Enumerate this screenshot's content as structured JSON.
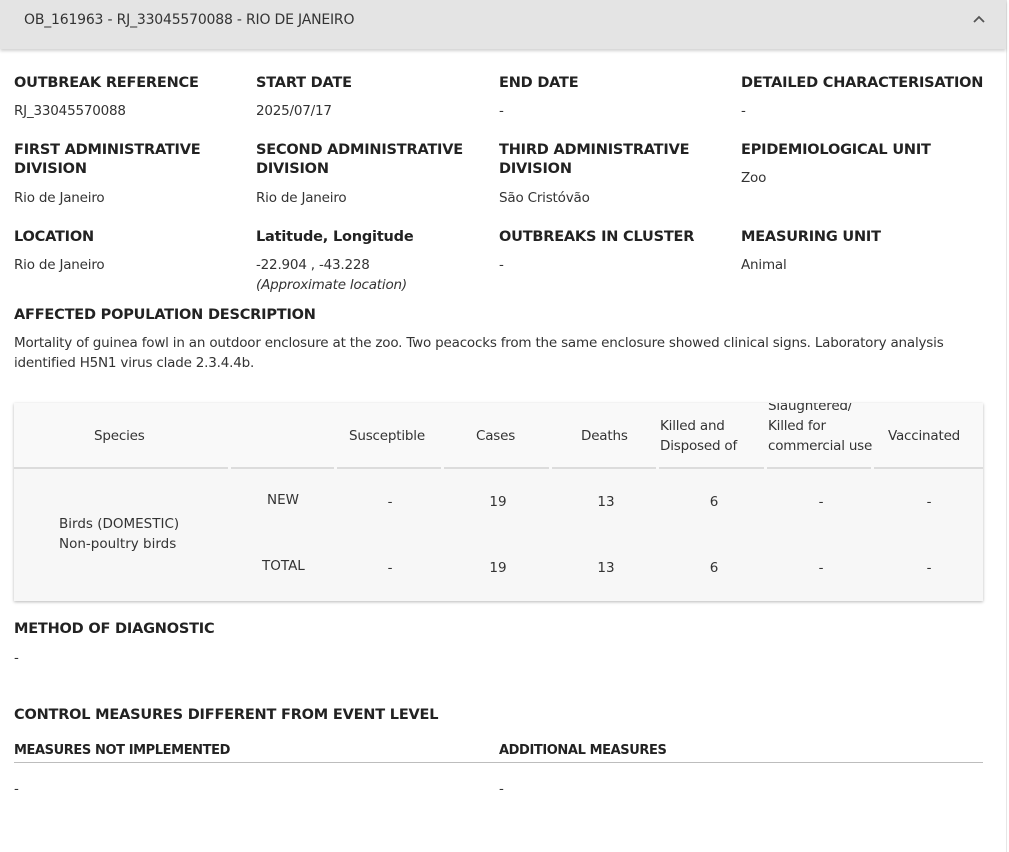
{
  "header": {
    "title": "OB_161963 - RJ_33045570088 - RIO DE JANEIRO"
  },
  "fields": {
    "outbreak_reference": {
      "label": "OUTBREAK REFERENCE",
      "value": "RJ_33045570088"
    },
    "start_date": {
      "label": "START DATE",
      "value": "2025/07/17"
    },
    "end_date": {
      "label": "END DATE",
      "value": "-"
    },
    "detailed_characterisation": {
      "label": "DETAILED CHARACTERISATION",
      "value": "-"
    },
    "first_admin": {
      "label": "FIRST ADMINISTRATIVE DIVISION",
      "value": "Rio de Janeiro"
    },
    "second_admin": {
      "label": "SECOND ADMINISTRATIVE DIVISION",
      "value": "Rio de Janeiro"
    },
    "third_admin": {
      "label": "THIRD ADMINISTRATIVE DIVISION",
      "value": "São Cristóvão"
    },
    "epi_unit": {
      "label": "EPIDEMIOLOGICAL UNIT",
      "value": "Zoo"
    },
    "location": {
      "label": "LOCATION",
      "value": "Rio de Janeiro"
    },
    "latlon": {
      "label": "Latitude, Longitude",
      "value": "-22.904 , -43.228",
      "note": "(Approximate location)"
    },
    "outbreaks_in_cluster": {
      "label": "OUTBREAKS IN CLUSTER",
      "value": "-"
    },
    "measuring_unit": {
      "label": "MEASURING UNIT",
      "value": "Animal"
    }
  },
  "affected_population": {
    "label": "AFFECTED POPULATION DESCRIPTION",
    "text": "Mortality of guinea fowl in an outdoor enclosure at the zoo. Two peacocks from the same enclosure showed clinical signs. Laboratory analysis identified H5N1 virus clade 2.3.4.4b."
  },
  "table": {
    "headers": {
      "species": "Species",
      "susceptible": "Susceptible",
      "cases": "Cases",
      "deaths": "Deaths",
      "killed": "Killed and Disposed of",
      "slaughtered": "Slaughtered/ Killed for commercial use",
      "vaccinated": "Vaccinated"
    },
    "species_name": "Birds (DOMESTIC) Non-poultry birds",
    "rows": [
      {
        "label": "NEW",
        "susceptible": "-",
        "cases": "19",
        "deaths": "13",
        "killed": "6",
        "slaughtered": "-",
        "vaccinated": "-"
      },
      {
        "label": "TOTAL",
        "susceptible": "-",
        "cases": "19",
        "deaths": "13",
        "killed": "6",
        "slaughtered": "-",
        "vaccinated": "-"
      }
    ]
  },
  "diagnostic": {
    "label": "METHOD OF DIAGNOSTIC",
    "value": "-"
  },
  "control": {
    "label": "CONTROL MEASURES DIFFERENT FROM EVENT LEVEL",
    "not_implemented_label": "MEASURES NOT IMPLEMENTED",
    "not_implemented_value": "-",
    "additional_label": "ADDITIONAL MEASURES",
    "additional_value": "-"
  }
}
